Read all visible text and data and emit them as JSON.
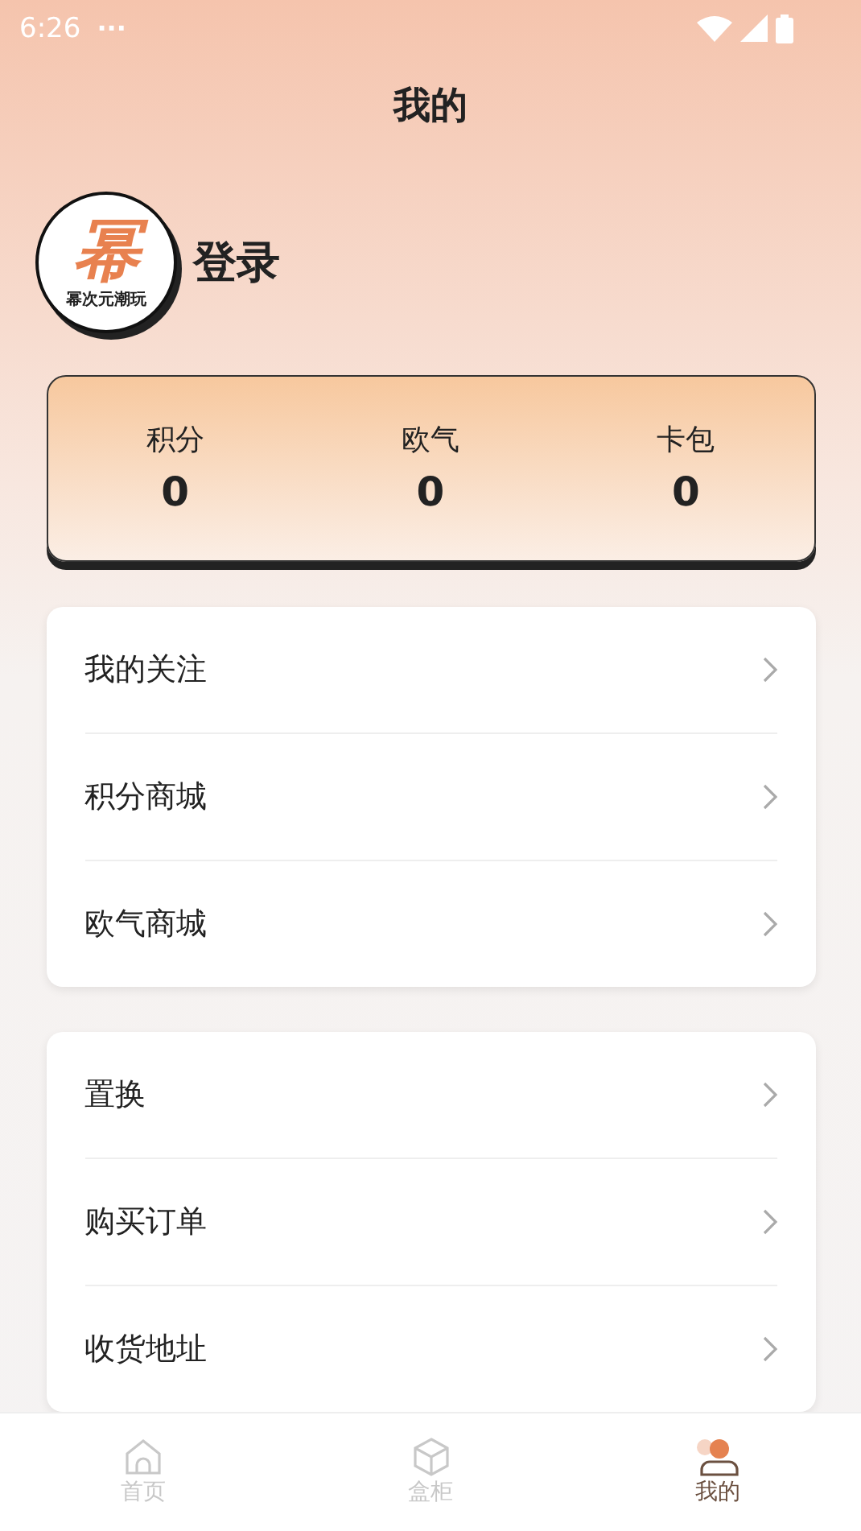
{
  "status_bar": {
    "time": "6:26",
    "dots": "···"
  },
  "title": "我的",
  "profile": {
    "logo_mark": "幂",
    "logo_caption": "幂次元潮玩",
    "login": "登录"
  },
  "stats": [
    {
      "label": "积分",
      "value": "0"
    },
    {
      "label": "欧气",
      "value": "0"
    },
    {
      "label": "卡包",
      "value": "0"
    }
  ],
  "menu_groups": [
    {
      "items": [
        "我的关注",
        "积分商城",
        "欧气商城"
      ]
    },
    {
      "items": [
        "置换",
        "购买订单",
        "收货地址"
      ]
    }
  ],
  "tab_bar": [
    {
      "label": "首页",
      "kind": "home",
      "selected": false
    },
    {
      "label": "盒柜",
      "kind": "box",
      "selected": false
    },
    {
      "label": "我的",
      "kind": "user",
      "selected": true
    }
  ]
}
